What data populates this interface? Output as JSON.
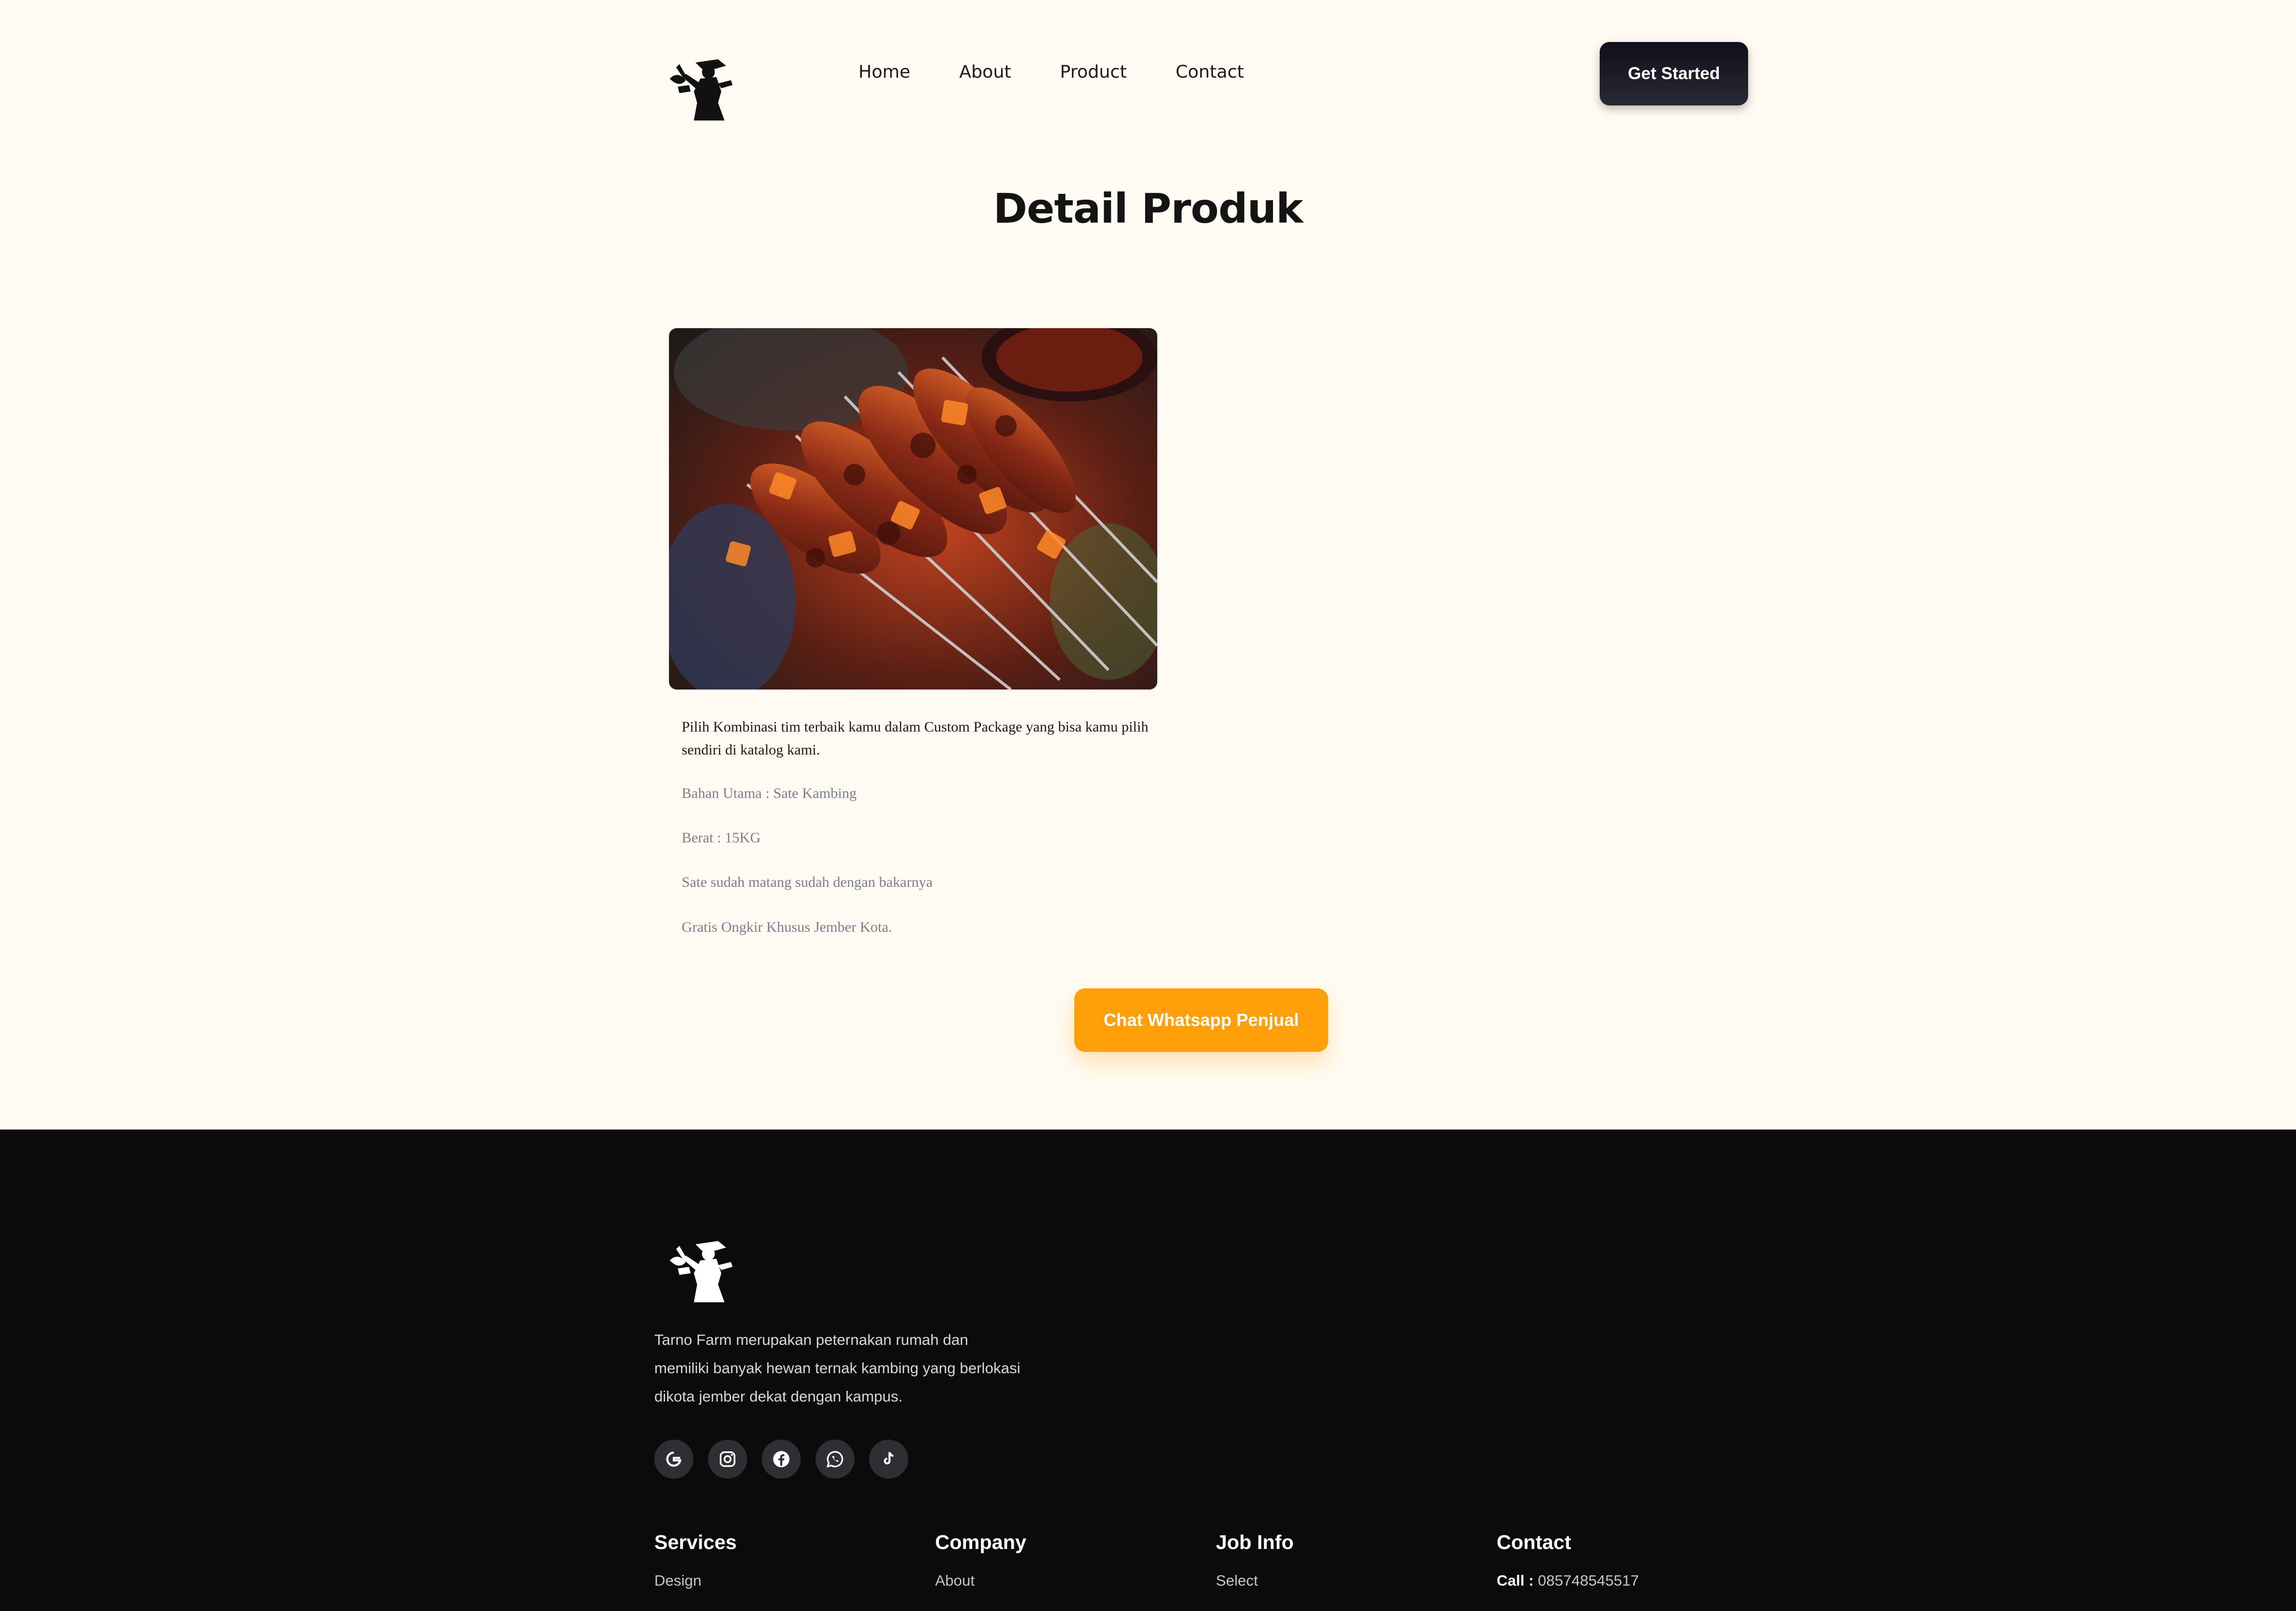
{
  "header": {
    "nav": [
      "Home",
      "About",
      "Product",
      "Contact"
    ],
    "cta_label": "Get Started"
  },
  "page": {
    "title": "Detail Produk"
  },
  "product": {
    "description": "Pilih Kombinasi tim terbaik kamu dalam Custom Package yang bisa kamu pilih sendiri di katalog kami.",
    "specs": [
      "Bahan Utama : Sate Kambing",
      "Berat : 15KG",
      "Sate sudah matang sudah dengan bakarnya",
      "Gratis Ongkir Khusus Jember Kota."
    ],
    "whatsapp_label": "Chat Whatsapp Penjual"
  },
  "footer": {
    "about": "Tarno Farm merupakan peternakan rumah dan memiliki banyak hewan ternak kambing yang berlokasi dikota jember dekat dengan kampus.",
    "socials": [
      "google-icon",
      "instagram-icon",
      "facebook-icon",
      "whatsapp-icon",
      "tiktok-icon"
    ],
    "columns": [
      {
        "heading": "Services",
        "first_link": "Design"
      },
      {
        "heading": "Company",
        "first_link": "About"
      },
      {
        "heading": "Job Info",
        "first_link": "Select"
      },
      {
        "heading": "Contact",
        "call_label": "Call :",
        "call_value": "085748545517"
      }
    ]
  },
  "colors": {
    "accent": "#ffa00a",
    "background": "#fffbf3",
    "footer": "#0b0b0b"
  }
}
